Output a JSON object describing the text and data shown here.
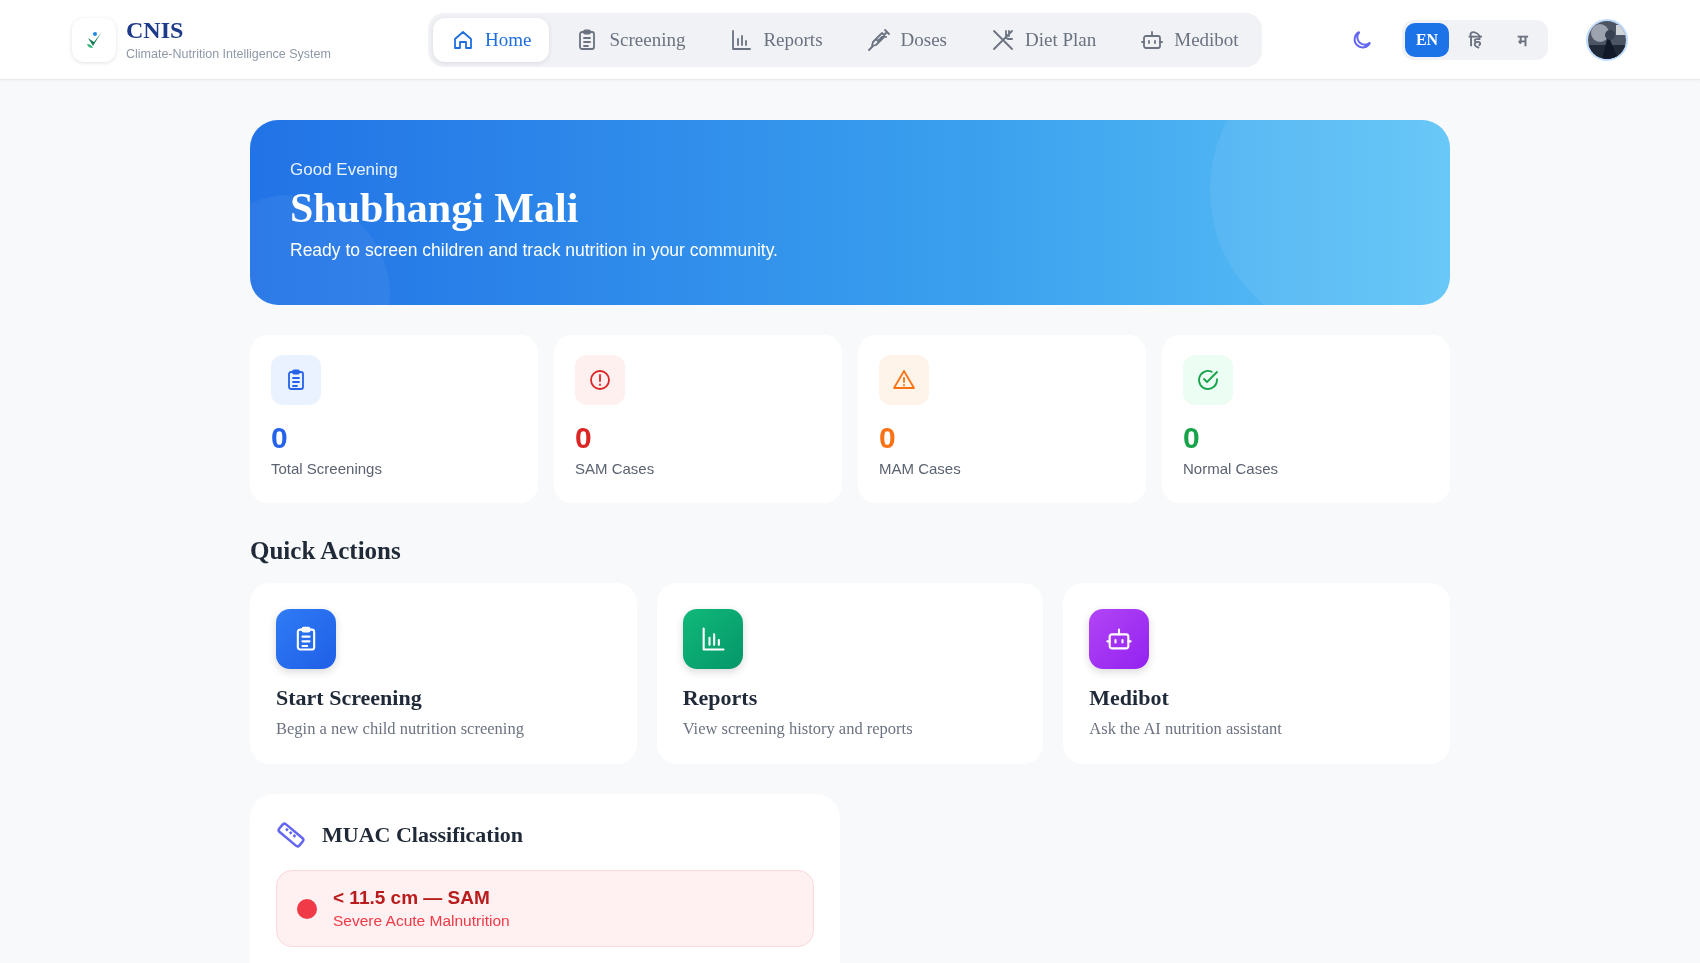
{
  "brand": {
    "title": "CNIS",
    "subtitle": "Climate-Nutrition Intelligence System"
  },
  "nav": [
    {
      "label": "Home",
      "kind": "home",
      "selected": true
    },
    {
      "label": "Screening",
      "kind": "clipboard",
      "selected": false
    },
    {
      "label": "Reports",
      "kind": "chart",
      "selected": false
    },
    {
      "label": "Doses",
      "kind": "syringe",
      "selected": false
    },
    {
      "label": "Diet Plan",
      "kind": "utensils",
      "selected": false
    },
    {
      "label": "Medibot",
      "kind": "bot",
      "selected": false
    }
  ],
  "languages": [
    {
      "label": "EN",
      "selected": true
    },
    {
      "label": "हि",
      "selected": false
    },
    {
      "label": "म",
      "selected": false
    }
  ],
  "hero": {
    "greeting": "Good Evening",
    "name": "Shubhangi Mali",
    "message": "Ready to screen children and track nutrition in your community."
  },
  "stats": [
    {
      "value": "0",
      "label": "Total Screenings",
      "kind": "total"
    },
    {
      "value": "0",
      "label": "SAM Cases",
      "kind": "sam"
    },
    {
      "value": "0",
      "label": "MAM Cases",
      "kind": "mam"
    },
    {
      "value": "0",
      "label": "Normal Cases",
      "kind": "normal"
    }
  ],
  "quick_actions": {
    "title": "Quick Actions",
    "items": [
      {
        "title": "Start Screening",
        "description": "Begin a new child nutrition screening",
        "kind": "screening"
      },
      {
        "title": "Reports",
        "description": "View screening history and reports",
        "kind": "reports"
      },
      {
        "title": "Medibot",
        "description": "Ask the AI nutrition assistant",
        "kind": "medibot"
      }
    ]
  },
  "muac": {
    "title": "MUAC Classification",
    "rows": [
      {
        "range": "< 11.5 cm — SAM",
        "description": "Severe Acute Malnutrition",
        "color": "#f03a47"
      }
    ]
  }
}
